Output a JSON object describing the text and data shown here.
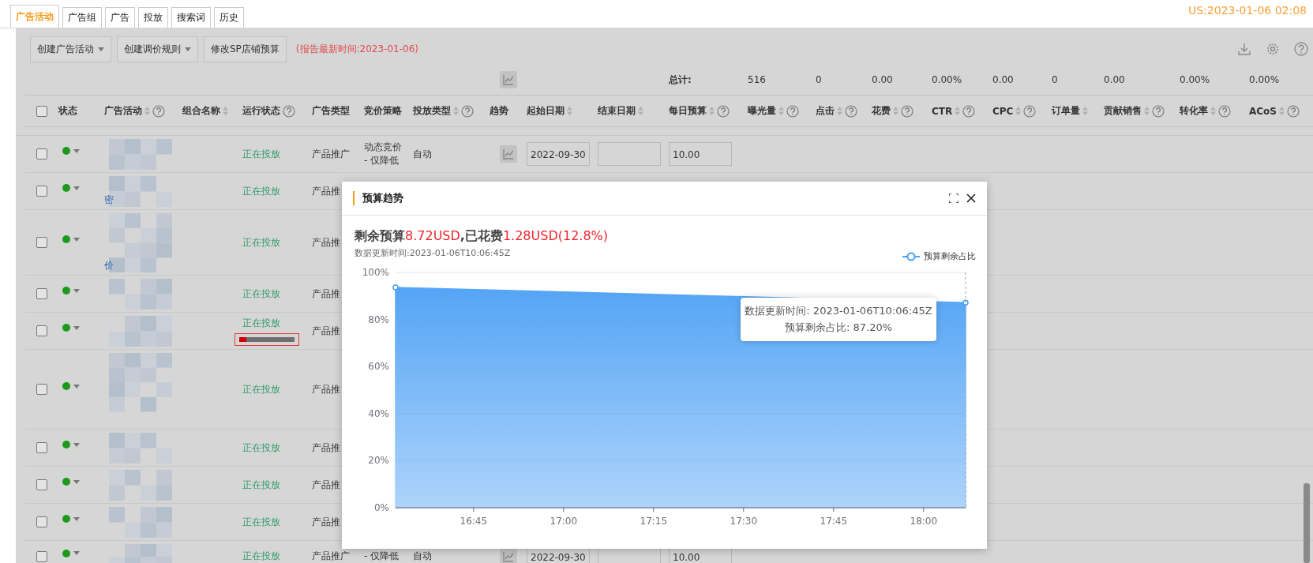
{
  "top_bar": {
    "tabs": [
      {
        "label": "广告活动",
        "selected": true
      },
      {
        "label": "广告组",
        "selected": false
      },
      {
        "label": "广告",
        "selected": false
      },
      {
        "label": "投放",
        "selected": false
      },
      {
        "label": "搜索词",
        "selected": false
      },
      {
        "label": "历史",
        "selected": false
      }
    ],
    "time": "US:2023-01-06 02:08"
  },
  "toolbar": {
    "buttons": [
      {
        "label": "创建广告活动",
        "dropdown": true
      },
      {
        "label": "创建调价规则",
        "dropdown": true
      },
      {
        "label": "修改SP店铺预算",
        "dropdown": false
      }
    ],
    "report_time": "(报告最新时间:2023-01-06)"
  },
  "totals": {
    "label": "总计:",
    "values": [
      "516",
      "0",
      "0.00",
      "0.00%",
      "0.00",
      "0",
      "0.00",
      "0.00%",
      "0.00%"
    ]
  },
  "table": {
    "select_all": {
      "checked": false
    },
    "columns": [
      {
        "label": "状态",
        "sortable": false,
        "help": false
      },
      {
        "label": "广告活动",
        "sortable": true,
        "help": true
      },
      {
        "label": "组合名称",
        "sortable": true,
        "help": false
      },
      {
        "label": "运行状态",
        "sortable": false,
        "help": true
      },
      {
        "label": "广告类型",
        "sortable": false,
        "help": false
      },
      {
        "label": "竞价策略",
        "sortable": false,
        "help": false
      },
      {
        "label": "投放类型",
        "sortable": true,
        "help": true
      },
      {
        "label": "趋势",
        "sortable": false,
        "help": false
      },
      {
        "label": "起始日期",
        "sortable": true,
        "help": false
      },
      {
        "label": "结束日期",
        "sortable": true,
        "help": false
      },
      {
        "label": "每日预算",
        "sortable": true,
        "help": true
      },
      {
        "label": "曝光量",
        "sortable": true,
        "help": true
      },
      {
        "label": "点击",
        "sortable": true,
        "help": true
      },
      {
        "label": "花费",
        "sortable": true,
        "help": true
      },
      {
        "label": "CTR",
        "sortable": true,
        "help": true
      },
      {
        "label": "CPC",
        "sortable": true,
        "help": true
      },
      {
        "label": "订单量",
        "sortable": true,
        "help": false
      },
      {
        "label": "贡献销售",
        "sortable": true,
        "help": true
      },
      {
        "label": "转化率",
        "sortable": true,
        "help": true
      },
      {
        "label": "ACoS",
        "sortable": true,
        "help": true
      }
    ],
    "rows": [
      {
        "checked": false,
        "run_status": "正在投放",
        "ad_type": "产品推广",
        "strategy": "动态竞价 - 仅降低",
        "delivery": "自动",
        "start_date": "2022-09-30",
        "budget": "10.00"
      },
      {
        "checked": false,
        "name_fragment": "密",
        "run_status": "正在投放",
        "ad_type": "产品推"
      },
      {
        "checked": false,
        "name_fragment": "价",
        "run_status": "正在投放",
        "ad_type": "产品推"
      },
      {
        "checked": false,
        "run_status": "正在投放",
        "ad_type": "产品推"
      },
      {
        "checked": false,
        "run_status": "正在投放",
        "ad_type": "产品推",
        "level": 0.13
      },
      {
        "checked": false,
        "run_status": "正在投放",
        "ad_type": "产品推"
      },
      {
        "checked": false,
        "run_status": "正在投放",
        "ad_type": "产品推"
      },
      {
        "checked": false,
        "run_status": "正在投放",
        "ad_type": "产品推"
      },
      {
        "checked": false,
        "run_status": "正在投放",
        "ad_type": "产品推"
      },
      {
        "checked": false,
        "run_status": "正在投放",
        "ad_type": "产品推广",
        "strategy": "- 仅降低",
        "delivery": "自动",
        "start_date": "2022-09-30",
        "budget": "10.00"
      }
    ]
  },
  "modal": {
    "title": "预算趋势",
    "summary": [
      {
        "kind": "label",
        "text": "剩余预算"
      },
      {
        "kind": "value",
        "text": "8.72USD"
      },
      {
        "kind": "label",
        "text": ",已花费"
      },
      {
        "kind": "value",
        "text": "1.28USD(12.8%)"
      }
    ],
    "updated": "数据更新时间:2023-01-06T10:06:45Z",
    "chart_data": {
      "type": "area",
      "x": [
        992,
        1087
      ],
      "xlim": [
        992,
        1087
      ],
      "ylim": [
        0,
        100
      ],
      "series": [
        {
          "name": "预算剩余占比",
          "color": "#4a9ff5",
          "values": [
            93.6,
            87.2
          ]
        }
      ],
      "xticks": [
        {
          "value": 1005,
          "label": "16:45"
        },
        {
          "value": 1020,
          "label": "17:00"
        },
        {
          "value": 1035,
          "label": "17:15"
        },
        {
          "value": 1050,
          "label": "17:30"
        },
        {
          "value": 1065,
          "label": "17:45"
        },
        {
          "value": 1080,
          "label": "18:00"
        }
      ],
      "yticks": [
        {
          "value": 0,
          "label": "0%"
        },
        {
          "value": 20,
          "label": "20%"
        },
        {
          "value": 40,
          "label": "40%"
        },
        {
          "value": 60,
          "label": "60%"
        },
        {
          "value": 80,
          "label": "80%"
        },
        {
          "value": 100,
          "label": "100%"
        }
      ]
    },
    "tooltip": {
      "lines": [
        "数据更新时间: 2023-01-06T10:06:45Z",
        "预算剩余占比: 87.20%"
      ]
    }
  }
}
